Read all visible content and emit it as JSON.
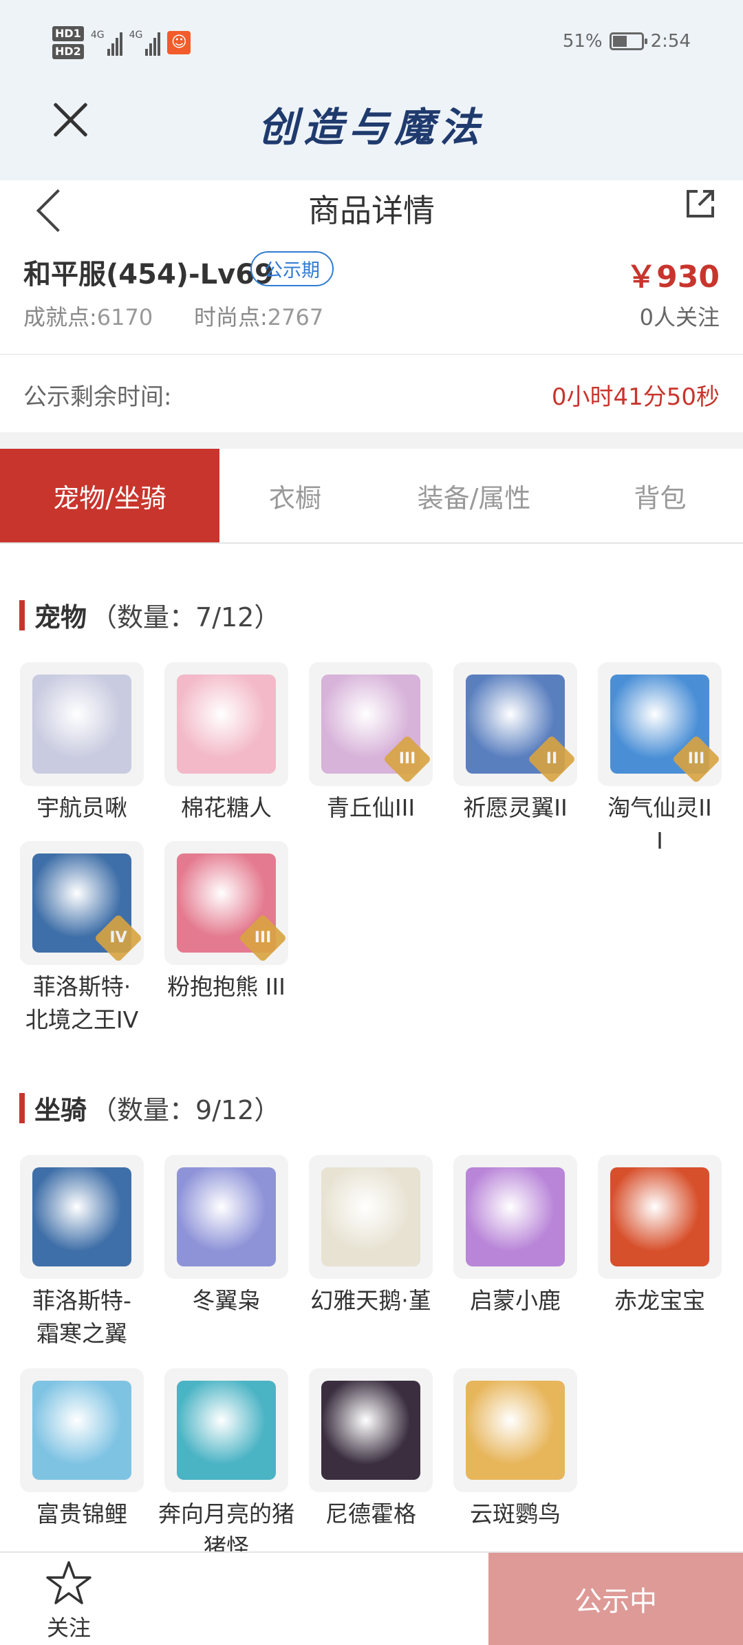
{
  "status_bar": {
    "sim1": "HD1",
    "sim2": "HD2",
    "network": "4G",
    "battery_text": "51%",
    "battery_level": 0.51,
    "time": "2:54"
  },
  "app": {
    "title": "创造与魔法"
  },
  "nav": {
    "title": "商品详情"
  },
  "product": {
    "server": "和平服(454)-Lv69",
    "badge": "公示期",
    "price": "￥930",
    "achievement_label": "成就点:",
    "achievement_value": "6170",
    "fashion_label": "时尚点:",
    "fashion_value": "2767",
    "followers": "0人关注"
  },
  "countdown": {
    "label": "公示剩余时间:",
    "value": "0小时41分50秒"
  },
  "tabs": [
    {
      "label": "宠物/坐骑",
      "active": true
    },
    {
      "label": "衣橱",
      "active": false
    },
    {
      "label": "装备/属性",
      "active": false
    },
    {
      "label": "背包",
      "active": false
    }
  ],
  "pets": {
    "title": "宠物",
    "count": "（数量：7/12）",
    "items": [
      {
        "name": "宇航员啾",
        "color": "#c9cbe0",
        "tier": ""
      },
      {
        "name": "棉花糖人",
        "color": "#f3b9c8",
        "tier": ""
      },
      {
        "name": "青丘仙III",
        "color": "#d7b2d9",
        "tier": "III"
      },
      {
        "name": "祈愿灵翼II",
        "color": "#5a7fbf",
        "tier": "II"
      },
      {
        "name": "淘气仙灵III",
        "color": "#4a8fd6",
        "tier": "III"
      },
      {
        "name": "菲洛斯特·北境之王IV",
        "color": "#3f6fa8",
        "tier": "IV"
      },
      {
        "name": "粉抱抱熊 III",
        "color": "#e47a8f",
        "tier": "III"
      }
    ]
  },
  "mounts": {
    "title": "坐骑",
    "count": "（数量：9/12）",
    "items": [
      {
        "name": "菲洛斯特-霜寒之翼",
        "color": "#3f6fa8"
      },
      {
        "name": "冬翼枭",
        "color": "#8e93d8"
      },
      {
        "name": "幻雅天鹅·堇",
        "color": "#e7e2d2"
      },
      {
        "name": "启蒙小鹿",
        "color": "#b985d8"
      },
      {
        "name": "赤龙宝宝",
        "color": "#d7502c"
      },
      {
        "name": "富贵锦鲤",
        "color": "#7fc3e3"
      },
      {
        "name": "奔向月亮的猪猪怪",
        "color": "#4ab3c4"
      },
      {
        "name": "尼德霍格",
        "color": "#3a2e3f"
      },
      {
        "name": "云斑鹦鸟",
        "color": "#e7b55a"
      }
    ]
  },
  "bottom": {
    "follow_label": "关注",
    "status_label": "公示中"
  },
  "colors": {
    "accent": "#c8352d",
    "badge": "#2f7bd3",
    "status_button": "#de9a97"
  }
}
